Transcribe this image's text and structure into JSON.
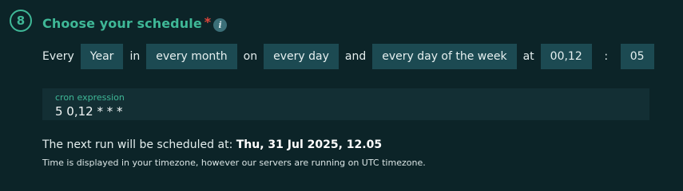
{
  "step": {
    "number": "8",
    "title": "Choose your schedule",
    "required_mark": "*",
    "info_glyph": "i"
  },
  "schedule": {
    "every_word": "Every",
    "frequency": "Year",
    "in_word": "in",
    "month": "every month",
    "on_word": "on",
    "day": "every day",
    "and_word": "and",
    "weekday": "every day of the week",
    "at_word": "at",
    "hours": "00,12",
    "colon": ":",
    "minutes": "05"
  },
  "cron": {
    "label": "cron expression",
    "value": "5 0,12 * * *"
  },
  "next_run": {
    "prefix": "The next run will be scheduled at:",
    "datetime": "Thu, 31 Jul 2025, 12.05"
  },
  "timezone_note": "Time is displayed in your timezone, however our servers are running on UTC timezone.",
  "colors": {
    "background": "#0c2428",
    "accent": "#3fb897",
    "required": "#e0463c",
    "select_bg": "#1c4a52",
    "cron_bg": "#132f34"
  }
}
